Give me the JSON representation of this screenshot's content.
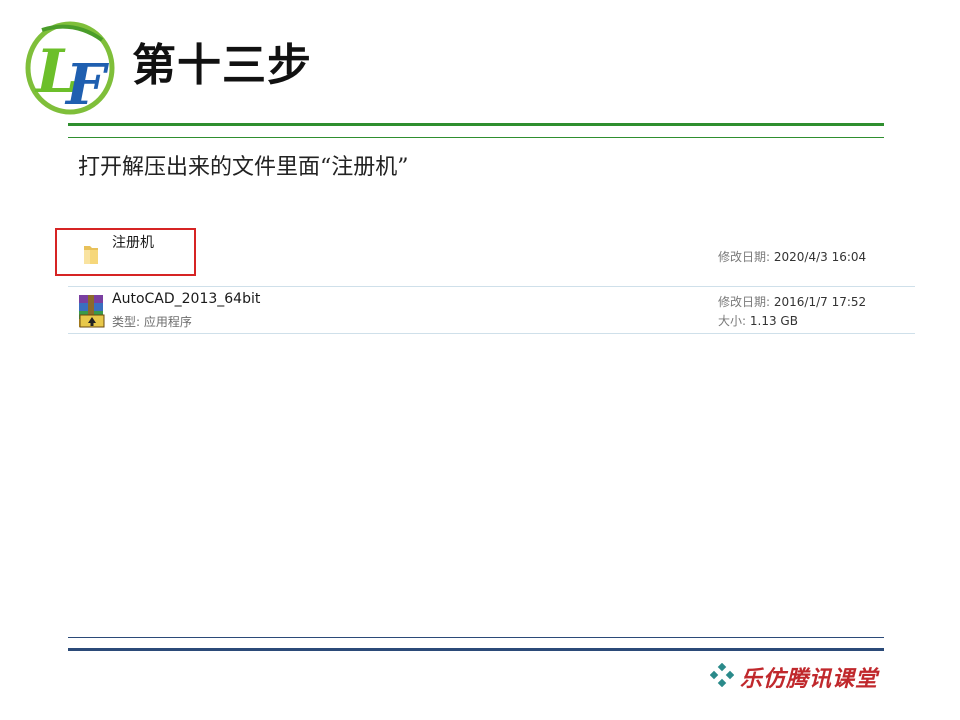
{
  "slide": {
    "title": "第十三步",
    "instruction": "打开解压出来的文件里面“注册机”",
    "colors": {
      "accent_green": "#2f8f2f",
      "accent_blue": "#2b4a78",
      "highlight_red": "#d62424",
      "brand_red": "#c0282c"
    }
  },
  "logo": {
    "icon": "lf-logo-icon",
    "text": "LF"
  },
  "explorer": {
    "items": [
      {
        "name": "注册机",
        "icon": "folder-icon",
        "modified_label": "修改日期:",
        "modified_value": "2020/4/3 16:04"
      },
      {
        "name": "AutoCAD_2013_64bit",
        "icon": "winrar-archive-icon",
        "type_label": "类型:",
        "type_value": "应用程序",
        "modified_label": "修改日期:",
        "modified_value": "2016/1/7 17:52",
        "size_label": "大小:",
        "size_value": "1.13 GB"
      }
    ]
  },
  "footer": {
    "brand": "乐仿腾讯课堂",
    "brand_icon": "diamond-cluster-icon"
  }
}
